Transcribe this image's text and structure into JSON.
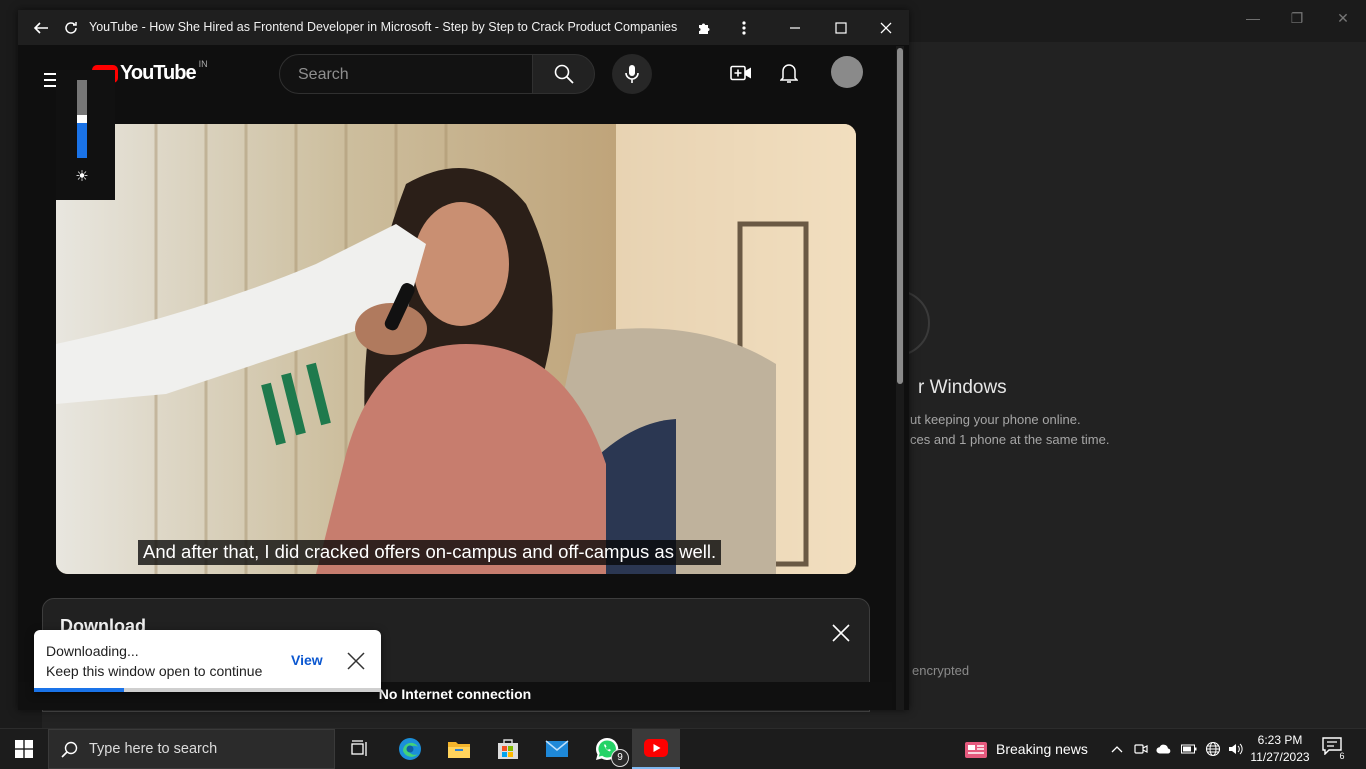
{
  "background_window": {
    "heading": "r Windows",
    "line1": "ut keeping your phone online.",
    "line2": "ces and 1 phone at the same time.",
    "footer": "encrypted"
  },
  "app_window": {
    "title": "YouTube - How She Hired as Frontend Developer in Microsoft - Step by Step to Crack Product Companies in..."
  },
  "youtube": {
    "logo_text": "YouTube",
    "country_code": "IN",
    "search_placeholder": "Search",
    "brightness_level": 0.45,
    "caption": "And after that, I did cracked offers on-campus and off-campus as well.",
    "download_panel_title": "Download",
    "offline_banner": "No Internet connection"
  },
  "toast": {
    "line1": "Downloading...",
    "line2": "Keep this window open to continue",
    "action": "View",
    "progress": 0.26
  },
  "taskbar": {
    "search_placeholder": "Type here to search",
    "whatsapp_badge": "9",
    "news_label": "Breaking news",
    "time": "6:23 PM",
    "date": "11/27/2023",
    "notification_count": "6"
  }
}
